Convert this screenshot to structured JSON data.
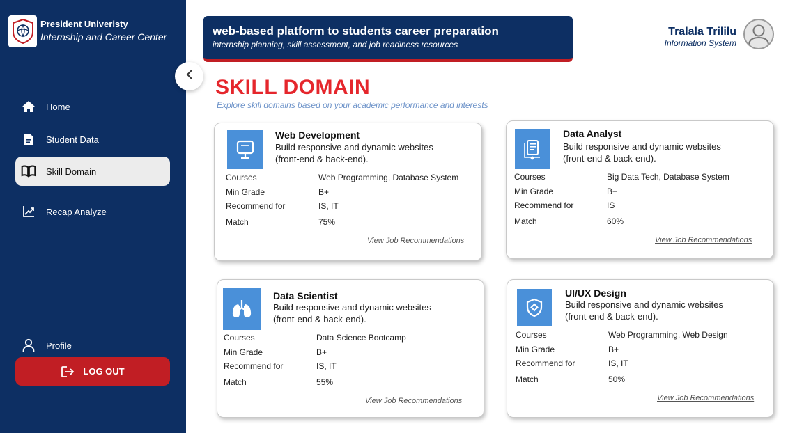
{
  "brand": {
    "name": "President Univeristy",
    "subtitle": "Internship and Career Center"
  },
  "nav": {
    "items": [
      {
        "label": "Home",
        "icon": "home-icon"
      },
      {
        "label": "Student Data",
        "icon": "document-icon"
      },
      {
        "label": "Skill Domain",
        "icon": "book-icon"
      },
      {
        "label": "Recap Analyze",
        "icon": "chart-icon"
      }
    ],
    "profile_label": "Profile",
    "logout_label": "LOG OUT"
  },
  "banner": {
    "title": "web-based platform to students career preparation",
    "subtitle": "internship planning, skill assessment, and job readiness resources"
  },
  "user": {
    "name": "Tralala Trililu",
    "role": "Information System"
  },
  "page": {
    "title": "SKILL DOMAIN",
    "subtitle": "Explore skill domains based on your academic performance and interests"
  },
  "row_labels": {
    "courses": "Courses",
    "min_grade": "Min Grade",
    "recommend": "Recommend for",
    "match": "Match"
  },
  "cards": [
    {
      "title": "Web Development",
      "desc": "Build responsive and dynamic websites (front-end & back-end).",
      "courses": "Web Programming, Database System",
      "min_grade": "B+",
      "recommend": "IS, IT",
      "match": "75%",
      "link": "View Job Recommendations",
      "icon": "monitor-icon"
    },
    {
      "title": "Data Analyst",
      "desc": "Build responsive and dynamic websites (front-end & back-end).",
      "courses": "Big Data Tech, Database System",
      "min_grade": "B+",
      "recommend": "IS",
      "match": "60%",
      "link": "View Job Recommendations",
      "icon": "report-icon"
    },
    {
      "title": "Data Scientist",
      "desc": "Build responsive and dynamic websites (front-end & back-end).",
      "courses": "Data Science Bootcamp",
      "min_grade": "B+",
      "recommend": "IS, IT",
      "match": "55%",
      "link": "View Job Recommendations",
      "icon": "lungs-icon"
    },
    {
      "title": "UI/UX Design",
      "desc": "Build responsive and dynamic websites (front-end & back-end).",
      "courses": "Web Programming, Web Design",
      "min_grade": "B+",
      "recommend": "IS, IT",
      "match": "50%",
      "link": "View Job Recommendations",
      "icon": "shield-icon"
    }
  ],
  "colors": {
    "sidebar": "#0d2f63",
    "accent_red": "#e5262c",
    "logout": "#c11e24",
    "icon_blue": "#4a90d9"
  }
}
